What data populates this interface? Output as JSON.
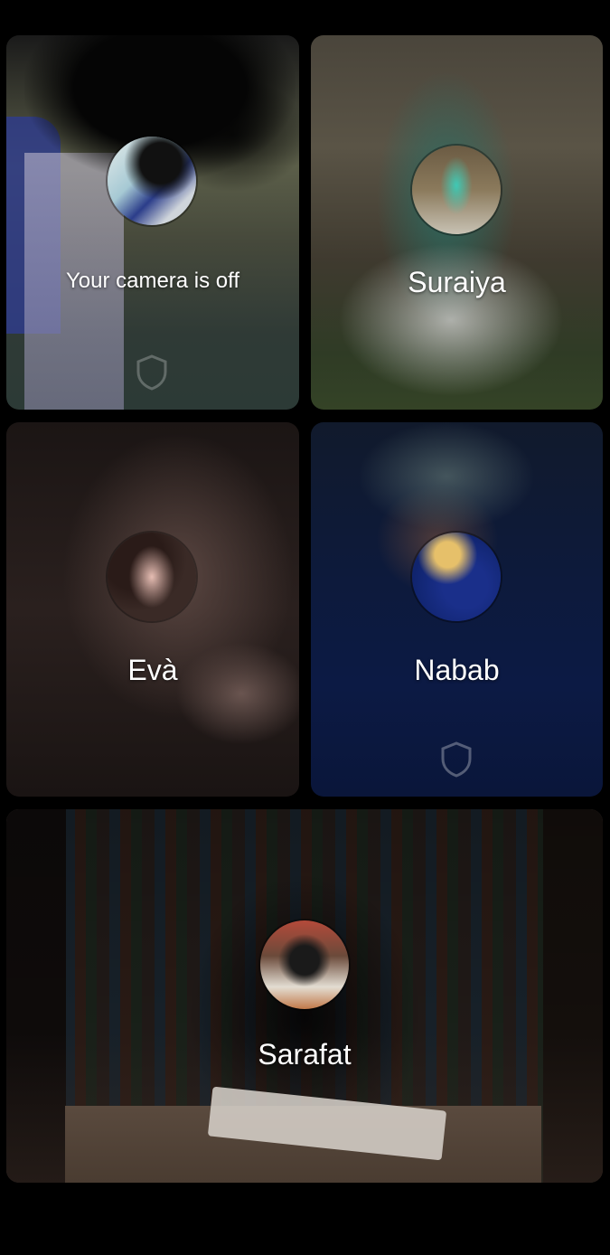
{
  "tiles": [
    {
      "id": "self",
      "label": "Your camera is off",
      "camera_off": true
    },
    {
      "id": "suraiya",
      "label": "Suraiya"
    },
    {
      "id": "eva",
      "label": "Evà"
    },
    {
      "id": "nabab",
      "label": "Nabab"
    },
    {
      "id": "sarafat",
      "label": "Sarafat"
    }
  ],
  "icons": {
    "shield": "shield-icon"
  },
  "colors": {
    "background": "#000000",
    "label_text": "#ffffff"
  }
}
